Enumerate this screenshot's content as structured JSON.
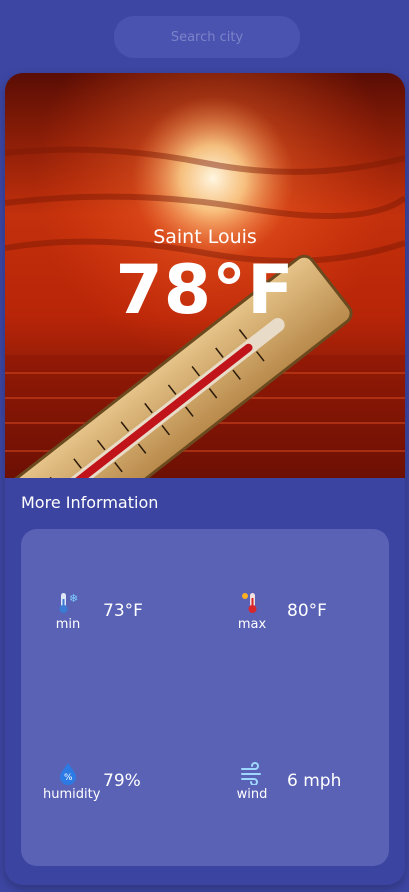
{
  "search": {
    "placeholder": "Search city"
  },
  "current": {
    "city": "Saint Louis",
    "temperature": "78°F"
  },
  "more_info": {
    "title": "More Information",
    "stats": [
      {
        "label": "min",
        "value": "73°F",
        "icon": "thermometer-snow-icon"
      },
      {
        "label": "max",
        "value": "80°F",
        "icon": "thermometer-sun-icon"
      },
      {
        "label": "humidity",
        "value": "79%",
        "icon": "humidity-drop-icon"
      },
      {
        "label": "wind",
        "value": "6 mph",
        "icon": "wind-icon"
      }
    ]
  },
  "colors": {
    "background": "#3d46a3",
    "panel": "#5a62b6",
    "accent": "#e0401a"
  }
}
